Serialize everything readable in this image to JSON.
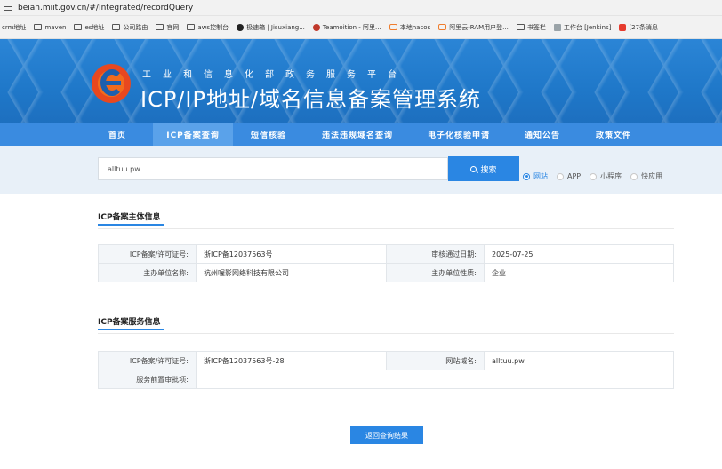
{
  "browser": {
    "url": "beian.miit.gov.cn/#/Integrated/recordQuery",
    "bookmarks": [
      {
        "label": "crm地址",
        "icon": "none"
      },
      {
        "label": "maven",
        "icon": "folder-icon"
      },
      {
        "label": "es地址",
        "icon": "folder-icon"
      },
      {
        "label": "公司路由",
        "icon": "folder-icon"
      },
      {
        "label": "官网",
        "icon": "folder-icon"
      },
      {
        "label": "aws控制台",
        "icon": "folder-icon"
      },
      {
        "label": "极速箱 | Jisuxiang...",
        "icon": "dot-icon"
      },
      {
        "label": "Teamoition - 阿里...",
        "icon": "globe-icon"
      },
      {
        "label": "本地nacos",
        "icon": "bracket-icon"
      },
      {
        "label": "阿里云-RAM用户登...",
        "icon": "bracket-icon"
      },
      {
        "label": "书签栏",
        "icon": "folder-icon"
      },
      {
        "label": "工作台 [Jenkins]",
        "icon": "worker-icon"
      },
      {
        "label": "(27条消息",
        "icon": "red-icon"
      }
    ]
  },
  "header": {
    "subtitle": "工业和信息化部政务服务平台",
    "title": "ICP/IP地址/域名信息备案管理系统"
  },
  "nav": {
    "items": [
      "首页",
      "ICP备案查询",
      "短信核验",
      "违法违规域名查询",
      "电子化核验申请",
      "通知公告",
      "政策文件"
    ],
    "active_index": 1
  },
  "search": {
    "value": "alltuu.pw",
    "button_label": "搜索",
    "types": [
      "网站",
      "APP",
      "小程序",
      "快应用"
    ],
    "selected_type": "网站"
  },
  "subject": {
    "section_title": "ICP备案主体信息",
    "rows": [
      {
        "k1": "ICP备案/许可证号:",
        "v1": "浙ICP备12037563号",
        "k2": "审核通过日期:",
        "v2": "2025-07-25"
      },
      {
        "k1": "主办单位名称:",
        "v1": "杭州喔影网络科技有限公司",
        "k2": "主办单位性质:",
        "v2": "企业"
      }
    ]
  },
  "service": {
    "section_title": "ICP备案服务信息",
    "rows": [
      {
        "k1": "ICP备案/许可证号:",
        "v1": "浙ICP备12037563号-28",
        "k2": "网站域名:",
        "v2": "alltuu.pw"
      },
      {
        "k1": "服务前置审批项:",
        "v1": ""
      }
    ]
  },
  "back_button_label": "返回查询结果",
  "colors": {
    "banner": "#1f78c9",
    "nav": "#3a8be0",
    "accent": "#2a86e3",
    "search_bg": "#e8f0f8"
  }
}
